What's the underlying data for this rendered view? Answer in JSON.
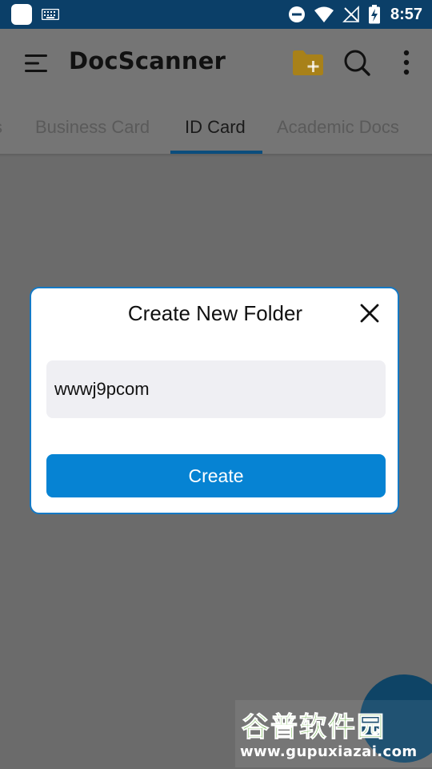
{
  "status_bar": {
    "time": "8:57",
    "icons": [
      "app-icon",
      "keyboard-icon",
      "do-not-disturb-icon",
      "wifi-icon",
      "no-signal-icon",
      "battery-charging-icon"
    ]
  },
  "app_bar": {
    "title": "DocScanner",
    "icons": [
      "menu-icon",
      "new-folder-icon",
      "search-icon",
      "more-vert-icon"
    ],
    "folder_icon_color": "#c99a1f"
  },
  "tabs": {
    "items": [
      {
        "label": "s"
      },
      {
        "label": "Business Card"
      },
      {
        "label": "ID Card",
        "active": true
      },
      {
        "label": "Academic Docs"
      }
    ],
    "indicator_color": "#0b4d7d"
  },
  "dialog": {
    "title": "Create New Folder",
    "input_value": "wwwj9pcom",
    "create_label": "Create",
    "border_color": "#1479c5",
    "button_color": "#0683d3",
    "input_bg": "#efeff3"
  },
  "watermark": {
    "text": "谷普软件园",
    "url": "www.gupuxiazai.com"
  }
}
